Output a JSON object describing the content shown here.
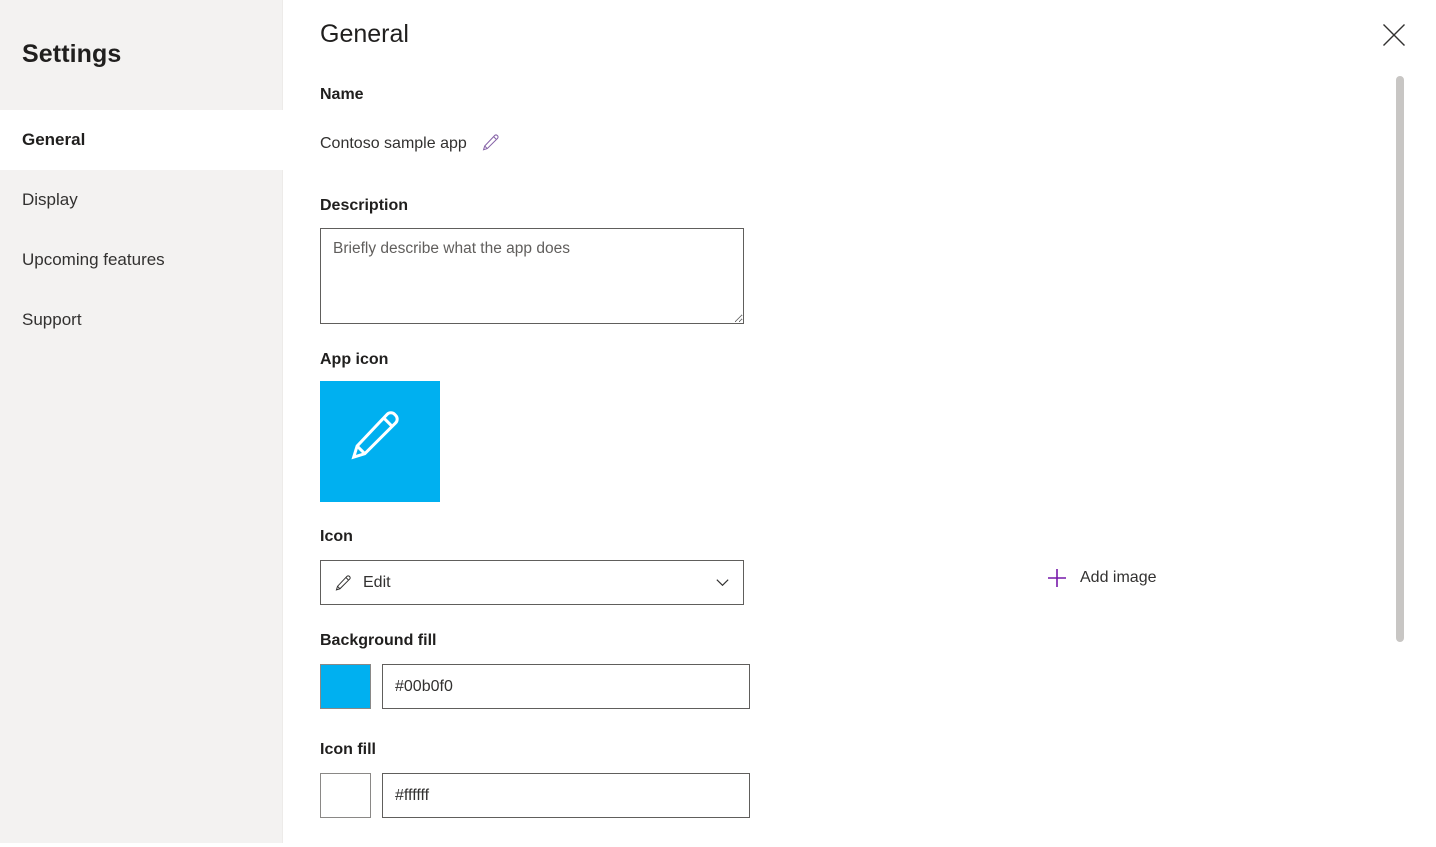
{
  "sidebar": {
    "title": "Settings",
    "items": [
      {
        "label": "General",
        "selected": true
      },
      {
        "label": "Display",
        "selected": false
      },
      {
        "label": "Upcoming features",
        "selected": false
      },
      {
        "label": "Support",
        "selected": false
      }
    ]
  },
  "header": {
    "title": "General",
    "close_icon": "close-icon"
  },
  "fields": {
    "name": {
      "label": "Name",
      "value": "Contoso sample app",
      "edit_icon": "pencil-icon"
    },
    "description": {
      "label": "Description",
      "value": "",
      "placeholder": "Briefly describe what the app does"
    },
    "app_icon": {
      "label": "App icon",
      "glyph": "pencil-icon"
    },
    "icon": {
      "label": "Icon",
      "selected": "Edit",
      "leading_icon": "pencil-icon",
      "chevron_icon": "chevron-down-icon"
    },
    "add_image": {
      "label": "Add image",
      "icon": "plus-icon"
    },
    "background_fill": {
      "label": "Background fill",
      "value": "#00b0f0"
    },
    "icon_fill": {
      "label": "Icon fill",
      "value": "#ffffff"
    }
  },
  "colors": {
    "accent_purple": "#7719aa",
    "app_icon_background": "#00b0f0",
    "app_icon_glyph": "#ffffff",
    "sidebar_background": "#f3f2f1",
    "text_primary": "#201f1e",
    "scrollbar_thumb": "#c8c6c4"
  }
}
